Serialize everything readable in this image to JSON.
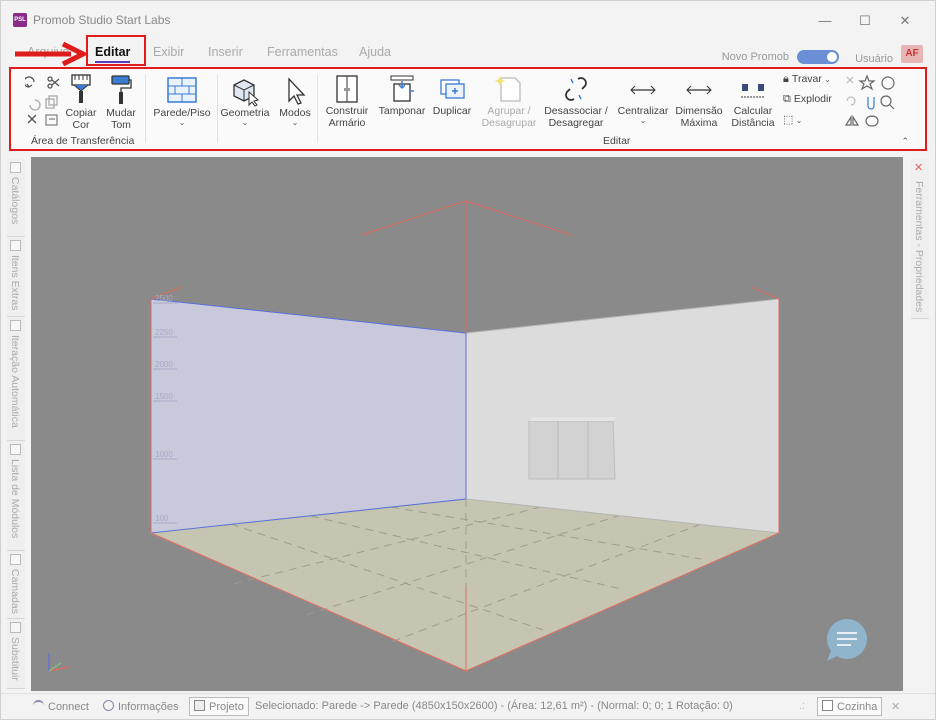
{
  "app": {
    "title": "Promob Studio Start Labs",
    "icon_text": "PSL",
    "icon_color": "#8a2b8a"
  },
  "window_controls": {
    "minimize": "—",
    "maximize": "☐",
    "close": "✕"
  },
  "tabs": [
    {
      "label": "Arquivo"
    },
    {
      "label": "Editar",
      "active": true
    },
    {
      "label": "Exibir"
    },
    {
      "label": "Inserir"
    },
    {
      "label": "Ferramentas"
    },
    {
      "label": "Ajuda"
    }
  ],
  "header_right": {
    "novo_promob": "Novo Promob",
    "novo_promob_on": true,
    "user": "Usuário",
    "avatar": "AF"
  },
  "ribbon": {
    "clipboard": {
      "copiar_cor": "Copiar Cor",
      "mudar_tom": "Mudar Tom",
      "group_label": "Área de Transferência"
    },
    "parede_piso": "Parede/Piso",
    "geometria": "Geometria",
    "modos": "Modos",
    "construir_armario": "Construir Armário",
    "tamponar": "Tamponar",
    "duplicar": "Duplicar",
    "agrupar": "Agrupar / Desagrupar",
    "desassociar": "Desassociar / Desagregar",
    "centralizar": "Centralizar",
    "dimensao_maxima": "Dimensão Máxima",
    "calcular_distancia": "Calcular Distância",
    "travar": "Travar",
    "explodir": "Explodir",
    "editar_group_label": "Editar"
  },
  "left_panels": [
    {
      "label": "Catálogos"
    },
    {
      "label": "Itens Extras"
    },
    {
      "label": "Iteração Automática"
    },
    {
      "label": "Lista de Módulos"
    },
    {
      "label": "Camadas"
    },
    {
      "label": "Substituir"
    }
  ],
  "right_panel": {
    "label": "Ferramentas - Propriedades"
  },
  "viewport": {
    "ruler_labels": [
      "2500",
      "2250",
      "2000",
      "1500",
      "1000",
      "100"
    ],
    "colors": {
      "background": "#8a8a8a",
      "left_wall": "#c9c9dc",
      "right_wall": "#dcdcdc",
      "floor": "#c6c5b2",
      "accent_red": "#e06a5e",
      "accent_blue": "#5a6fd8"
    }
  },
  "status": {
    "connect": "Connect",
    "informacoes": "Informações",
    "projeto": "Projeto",
    "selected": "Selecionado: Parede -> Parede (4850x150x2600) - (Área: 12,61 m²) - (Normal: 0; 0; 1 Rotação: 0)",
    "ambiente": "Cozinha"
  }
}
